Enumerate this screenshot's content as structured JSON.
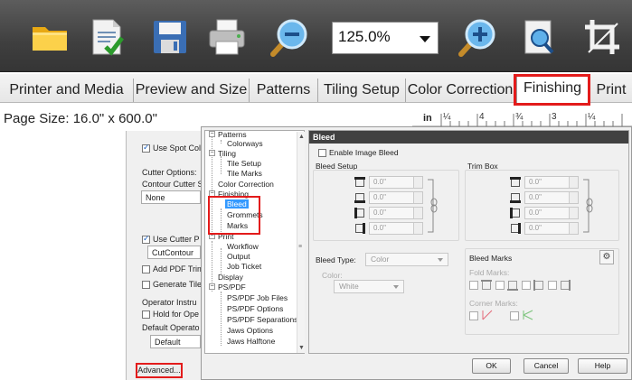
{
  "toolbar": {
    "buttons": [
      {
        "name": "folder-icon"
      },
      {
        "name": "document-check-icon"
      },
      {
        "name": "save-icon"
      },
      {
        "name": "printer-icon"
      },
      {
        "name": "zoom-out-icon"
      },
      {
        "name": "zoom-in-icon"
      },
      {
        "name": "zoom-page-icon"
      },
      {
        "name": "crop-icon"
      }
    ],
    "zoom_value": "125.0%"
  },
  "tabs": [
    {
      "label": "Printer and Media"
    },
    {
      "label": "Preview and Size"
    },
    {
      "label": "Patterns"
    },
    {
      "label": "Tiling Setup"
    },
    {
      "label": "Color Correction"
    },
    {
      "label": "Finishing",
      "active": true
    },
    {
      "label": "Print"
    }
  ],
  "page_size": "Page Size: 16.0\" x 600.0\"",
  "ruler": {
    "unit": "in",
    "marks": [
      "¼",
      "4",
      "¾",
      "3",
      "¼"
    ]
  },
  "under_panel": {
    "use_spot_colors": "Use Spot Col",
    "cutter_options": "Cutter Options:",
    "contour_cutter": "Contour Cutter S",
    "none_value": "None",
    "use_cutter": "Use Cutter P",
    "cut_contour": "CutContour",
    "add_pdf_trim": "Add PDF Trim",
    "generate_tile": "Generate Tile",
    "operator_instructions": "Operator Instru",
    "hold_for_operator": "Hold for Ope",
    "default_operator": "Default Operato",
    "default_value": "Default",
    "advanced_button": "Advanced..."
  },
  "tree": {
    "patterns": "Patterns",
    "colorways": "Colorways",
    "tiling": "Tiling",
    "tile_setup": "Tile Setup",
    "tile_marks": "Tile Marks",
    "color_correction": "Color Correction",
    "finishing": "Finishing",
    "bleed": "Bleed",
    "grommets": "Grommets",
    "marks": "Marks",
    "print": "Print",
    "workflow": "Workflow",
    "output": "Output",
    "job_ticket": "Job Ticket",
    "display": "Display",
    "ps_pdf": "PS/PDF",
    "ps_pdf_job_files": "PS/PDF Job Files",
    "ps_pdf_options": "PS/PDF Options",
    "ps_pdf_separations": "PS/PDF Separations",
    "jaws_options": "Jaws Options",
    "jaws_halftone": "Jaws Halftone"
  },
  "bleed": {
    "header": "Bleed",
    "enable_image_bleed": "Enable Image Bleed",
    "bleed_setup": "Bleed Setup",
    "trim_box": "Trim Box",
    "bleed_values": [
      "0.0\"",
      "0.0\"",
      "0.0\"",
      "0.0\""
    ],
    "trim_values": [
      "0.0\"",
      "0.0\"",
      "0.0\"",
      "0.0\""
    ],
    "bleed_type_label": "Bleed Type:",
    "bleed_type_value": "Color",
    "color_label": "Color:",
    "color_value": "White",
    "bleed_marks": "Bleed Marks",
    "fold_marks": "Fold Marks:",
    "corner_marks": "Corner Marks:"
  },
  "dialog_buttons": {
    "ok": "OK",
    "cancel": "Cancel",
    "help": "Help"
  },
  "colors": {
    "highlight": "#e31b1b",
    "selection": "#3399ff",
    "panel_header": "#414141"
  }
}
